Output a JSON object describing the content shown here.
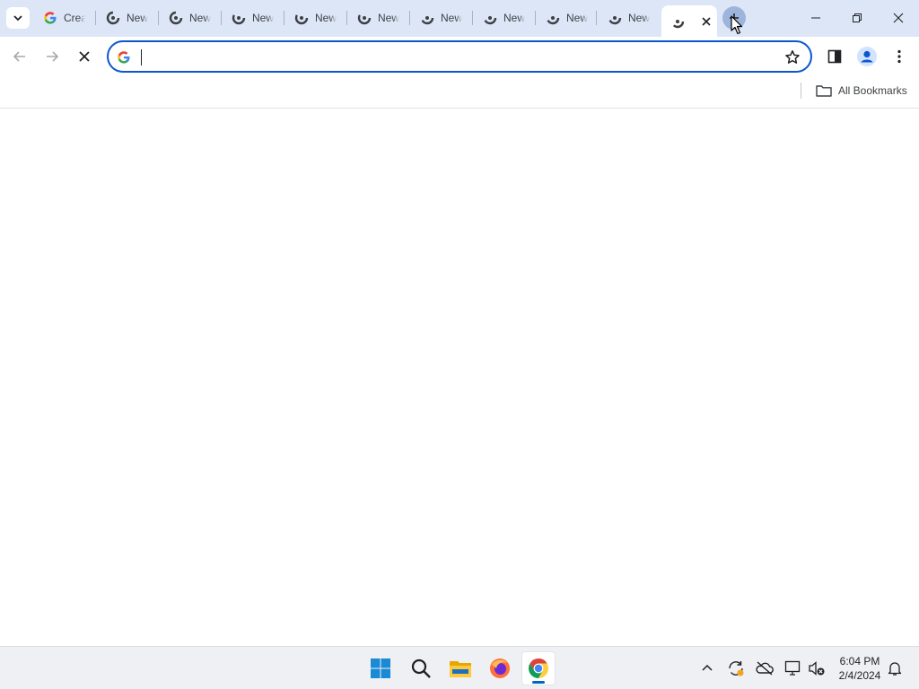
{
  "browser": {
    "tabs": [
      {
        "title": "Create",
        "favicon": "google-g-icon",
        "active": false
      },
      {
        "title": "New Tab",
        "favicon": "loading-spinner-icon",
        "active": false
      },
      {
        "title": "New Tab",
        "favicon": "loading-spinner-icon",
        "active": false
      },
      {
        "title": "New Tab",
        "favicon": "loading-spinner-icon",
        "active": false
      },
      {
        "title": "New Tab",
        "favicon": "loading-spinner-icon",
        "active": false
      },
      {
        "title": "New Tab",
        "favicon": "loading-spinner-icon",
        "active": false
      },
      {
        "title": "New Tab",
        "favicon": "loading-spinner-icon",
        "active": false
      },
      {
        "title": "New Tab",
        "favicon": "loading-spinner-icon",
        "active": false
      },
      {
        "title": "New Tab",
        "favicon": "loading-spinner-icon",
        "active": false
      },
      {
        "title": "New Tab",
        "favicon": "loading-spinner-icon",
        "active": false
      },
      {
        "title": "",
        "favicon": "loading-spinner-icon",
        "active": true
      }
    ],
    "new_tab_icon": "plus-icon",
    "window_controls": [
      "minimize-icon",
      "restore-icon",
      "close-icon"
    ]
  },
  "toolbar": {
    "back_icon": "arrow-left-icon",
    "forward_icon": "arrow-right-icon",
    "stop_icon": "stop-icon",
    "omnibox": {
      "value": "",
      "placeholder": ""
    },
    "icons": [
      "bookmark-star-icon",
      "side-panel-icon",
      "profile-icon",
      "more-menu-icon"
    ]
  },
  "bookmarks_bar": {
    "all_bookmarks_label": "All Bookmarks"
  },
  "taskbar": {
    "apps": [
      "windows-start-icon",
      "search-icon",
      "file-explorer-icon",
      "firefox-icon",
      "chrome-icon"
    ],
    "tray": [
      "chevron-up-icon",
      "sync-icon",
      "onedrive-icon",
      "network-icon",
      "volume-muted-icon"
    ],
    "time": "6:04 PM",
    "date": "2/4/2024"
  },
  "colors": {
    "tabstrip_bg": "#dce6f7",
    "accent": "#0b57d0",
    "taskbar_bg": "#eef0f4"
  }
}
